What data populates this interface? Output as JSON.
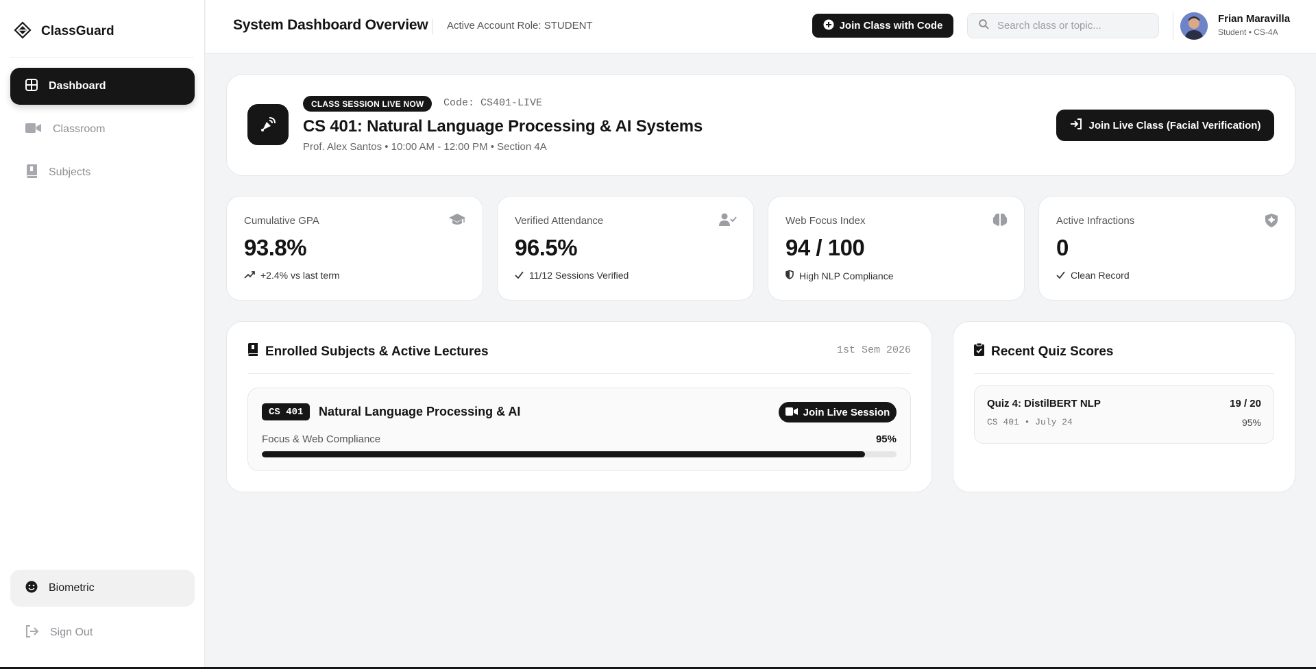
{
  "app": {
    "name": "ClassGuard"
  },
  "sidebar": {
    "items": [
      {
        "label": "Dashboard",
        "icon": "dashboard-grid-icon",
        "active": true
      },
      {
        "label": "Classroom",
        "icon": "video-camera-icon",
        "active": false
      },
      {
        "label": "Subjects",
        "icon": "book-icon",
        "active": false
      }
    ],
    "biometric_label": "Biometric",
    "signout_label": "Sign Out"
  },
  "header": {
    "title": "System Dashboard Overview",
    "role_text": "Active Account Role: STUDENT",
    "join_code_label": "Join Class with Code",
    "search_placeholder": "Search class or topic...",
    "user_name": "Frian Maravilla",
    "user_sub": "Student • CS-4A"
  },
  "live_session": {
    "badge": "CLASS SESSION LIVE NOW",
    "code": "Code: CS401-LIVE",
    "title": "CS 401: Natural Language Processing & AI Systems",
    "meta": "Prof. Alex Santos • 10:00 AM - 12:00 PM • Section 4A",
    "join_label": "Join Live Class (Facial Verification)"
  },
  "stats": [
    {
      "label": "Cumulative GPA",
      "value": "93.8%",
      "foot": "+2.4% vs last term",
      "icon": "graduation-cap-icon",
      "foot_icon": "trend-up-icon"
    },
    {
      "label": "Verified Attendance",
      "value": "96.5%",
      "foot": "11/12 Sessions Verified",
      "icon": "user-check-icon",
      "foot_icon": "check-icon"
    },
    {
      "label": "Web Focus Index",
      "value": "94 / 100",
      "foot": "High NLP Compliance",
      "icon": "brain-icon",
      "foot_icon": "shield-icon"
    },
    {
      "label": "Active Infractions",
      "value": "0",
      "foot": "Clean Record",
      "icon": "shield-badge-icon",
      "foot_icon": "check-icon"
    }
  ],
  "enrolled": {
    "title": "Enrolled Subjects & Active Lectures",
    "semester": "1st Sem 2026",
    "subjects": [
      {
        "code": "CS 401",
        "name": "Natural Language Processing & AI",
        "join_label": "Join Live Session",
        "focus_label": "Focus & Web Compliance",
        "focus_value": "95%",
        "focus_fraction": 0.95
      }
    ]
  },
  "quiz": {
    "title": "Recent Quiz Scores",
    "items": [
      {
        "name": "Quiz 4: DistilBERT NLP",
        "score": "19 / 20",
        "meta": "CS 401 • July 24",
        "percent": "95%"
      }
    ]
  },
  "colors": {
    "accent": "#161616",
    "background": "#f3f4f6",
    "card": "#ffffff"
  }
}
